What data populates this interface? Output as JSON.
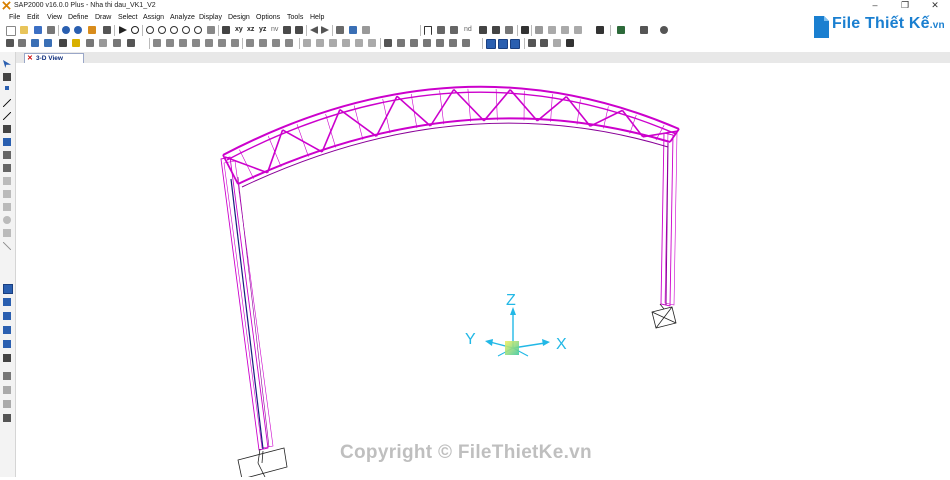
{
  "app": {
    "title": "SAP2000 v16.0.0 Plus  - Nha thi dau_VK1_V2",
    "window_controls": {
      "minimize": "–",
      "maximize": "❐",
      "close": "✕"
    }
  },
  "menu": {
    "items": [
      "File",
      "Edit",
      "View",
      "Define",
      "Draw",
      "Select",
      "Assign",
      "Analyze",
      "Display",
      "Design",
      "Options",
      "Tools",
      "Help"
    ]
  },
  "toolbar": {
    "view_xy": "xy",
    "view_xz": "xz",
    "view_yz": "yz",
    "view_nv": "nv",
    "view_nd": "nd"
  },
  "tab": {
    "close": "✕",
    "label": "3-D View"
  },
  "axes": {
    "z": "Z",
    "y": "Y",
    "x": "X"
  },
  "logo": {
    "main": "File Thiết Kế",
    "suffix": ".vn"
  },
  "watermark": "Copyright © FileThietKe.vn",
  "colors": {
    "frame": "#cc00cc",
    "frame_dark": "#8a0098",
    "column_line": "#1a1a80",
    "axis": "#22b8e6",
    "logo_blue": "#1a7fd0",
    "watermark": "#bfbfbf"
  }
}
